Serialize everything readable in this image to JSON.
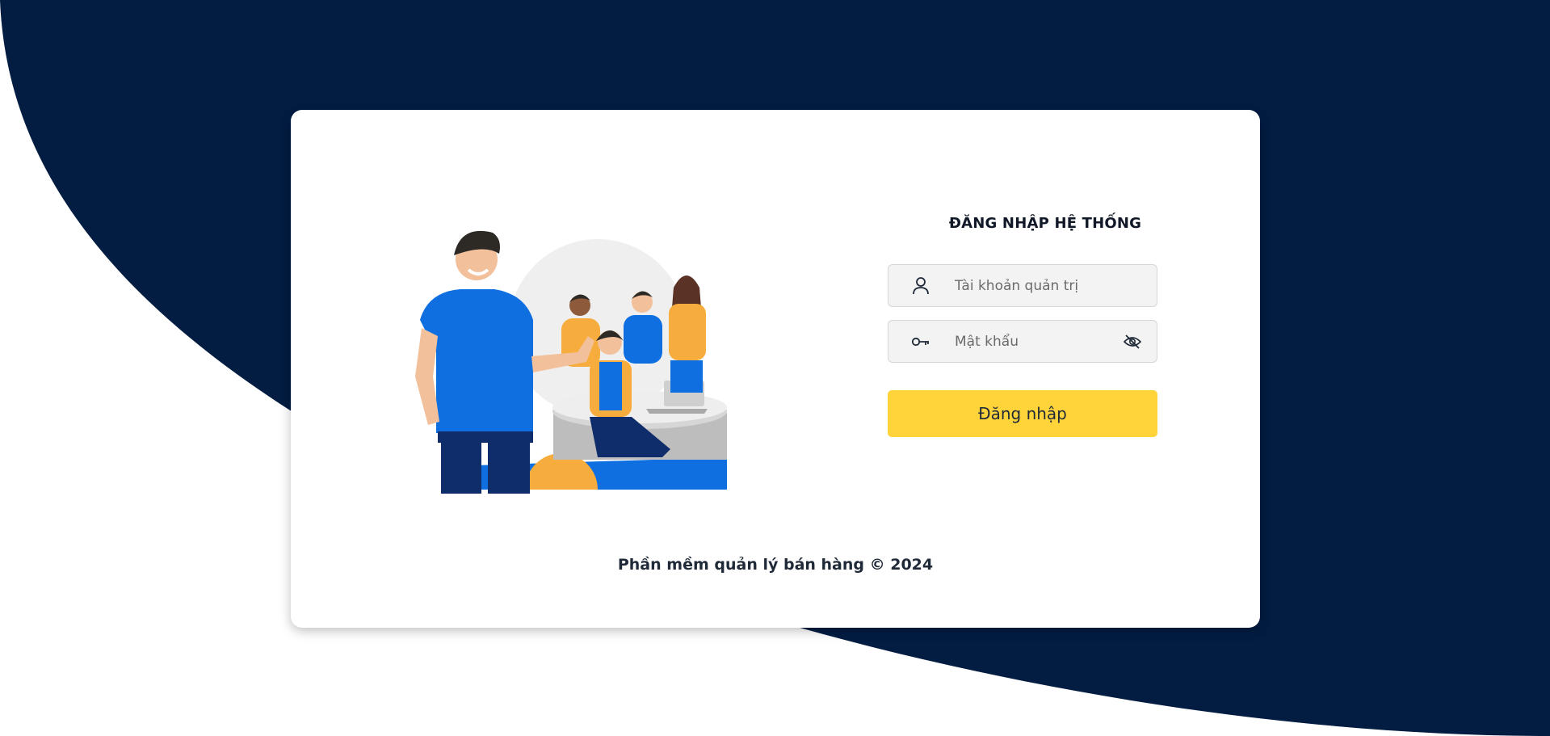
{
  "login": {
    "title": "ĐĂNG NHẬP HỆ THỐNG",
    "username_placeholder": "Tài khoản quản trị",
    "username_value": "",
    "password_placeholder": "Mật khẩu",
    "password_value": "",
    "submit_label": "Đăng nhập"
  },
  "footer": {
    "copyright": "Phần mềm quản lý bán hàng © 2024"
  },
  "icons": {
    "username": "user-icon",
    "password": "key-icon",
    "toggle_password": "eye-off-icon"
  },
  "colors": {
    "background_shape": "#021c42",
    "login_button": "#ffd43b",
    "card": "#ffffff",
    "illustration_blue": "#0f6fe0",
    "illustration_orange": "#f7ad3d"
  }
}
